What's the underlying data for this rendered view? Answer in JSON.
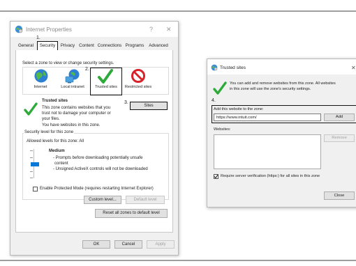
{
  "internet_properties": {
    "title": "Internet Properties",
    "help": "?",
    "close": "✕",
    "tabs": [
      "General",
      "Security",
      "Privacy",
      "Content",
      "Connections",
      "Programs",
      "Advanced"
    ],
    "zone_prompt": "Select a zone to view or change security settings.",
    "zones": [
      "Internet",
      "Local intranet",
      "Trusted sites",
      "Restricted sites"
    ],
    "selected_zone": {
      "name": "Trusted sites",
      "desc1": "This zone contains websites that you",
      "desc2": "trust not to damage your computer or",
      "desc3": "your files.",
      "desc4": "You have websites in this zone."
    },
    "sites_button": "Sites",
    "security_level_heading": "Security level for this zone",
    "allowed_levels": "Allowed levels for this zone: All",
    "level_name": "Medium",
    "level_desc1": "- Prompts before downloading potentially unsafe",
    "level_desc2": "content",
    "level_desc3": "- Unsigned ActiveX controls will not be downloaded",
    "protected_mode": "Enable Protected Mode (requires restarting Internet Explorer)",
    "custom_level": "Custom level...",
    "default_level": "Default level",
    "reset_all": "Reset all zones to default level",
    "ok": "OK",
    "cancel": "Cancel",
    "apply": "Apply"
  },
  "steps": {
    "s1": "1.",
    "s2": "2.",
    "s3": "3.",
    "s4": "4."
  },
  "trusted_sites": {
    "title": "Trusted sites",
    "close": "✕",
    "info1": "You can add and remove websites from this zone. All websites",
    "info2": "in this zone will use the zone's security settings.",
    "add_label": "Add this website to the zone:",
    "url_value": "https://www.intuit.com/",
    "add_button": "Add",
    "websites_label": "Websites:",
    "remove_button": "Remove",
    "require_https": "Require server verification (https:) for all sites in this zone",
    "require_https_checked": true,
    "close_button": "Close"
  }
}
